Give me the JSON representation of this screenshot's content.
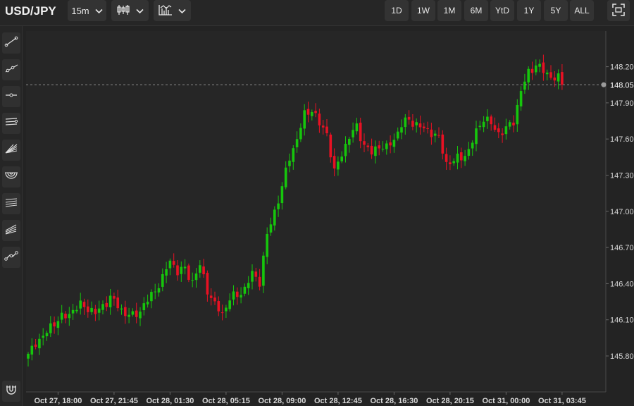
{
  "header": {
    "symbol": "USD/JPY",
    "interval": "15m",
    "chart_type_icon": "candlestick-icon",
    "indicators_icon": "indicators-icon",
    "ranges": [
      "1D",
      "1W",
      "1M",
      "6M",
      "YtD",
      "1Y",
      "5Y",
      "ALL"
    ],
    "fullscreen_icon": "fullscreen-icon"
  },
  "sidebar": {
    "tools": [
      "trend-line-icon",
      "ray-icon",
      "horizontal-line-icon",
      "parallel-channel-icon",
      "fib-fan-icon",
      "fib-arcs-icon",
      "fib-retracement-icon",
      "pitchfork-icon",
      "polyline-icon"
    ],
    "bottom_tool": "magnet-icon"
  },
  "chart_data": {
    "type": "candlestick",
    "y_ticks": [
      145.8,
      146.1,
      146.4,
      146.7,
      147.0,
      147.3,
      147.6,
      147.9,
      148.2
    ],
    "y_tick_labels": [
      "145.80",
      "146.10",
      "146.40",
      "146.70",
      "147.00",
      "147.30",
      "147.60",
      "147.90",
      "148.20"
    ],
    "ylim": [
      145.53,
      148.5
    ],
    "x_tick_labels": [
      "Oct 27, 18:00",
      "Oct 27, 21:45",
      "Oct 28, 01:30",
      "Oct 28, 05:15",
      "Oct 28, 09:00",
      "Oct 28, 12:45",
      "Oct 28, 16:30",
      "Oct 28, 20:15",
      "Oct 31, 00:00",
      "Oct 31, 03:45"
    ],
    "x_tick_index": [
      8,
      23,
      38,
      53,
      68,
      83,
      98,
      113,
      128,
      143
    ],
    "n_bars": 144,
    "last_price": 148.05,
    "last_price_label": "148.05",
    "grid": false,
    "colors": {
      "up": "#16c60c",
      "down": "#e81123",
      "background": "#262626",
      "axis_text": "#d8d8d8",
      "price_line": "#8a8a8a"
    },
    "anchors": [
      [
        0,
        145.8
      ],
      [
        2,
        145.92
      ],
      [
        4,
        145.95
      ],
      [
        6,
        146.05
      ],
      [
        8,
        146.1
      ],
      [
        10,
        146.13
      ],
      [
        12,
        146.18
      ],
      [
        14,
        146.22
      ],
      [
        16,
        146.2
      ],
      [
        18,
        146.15
      ],
      [
        20,
        146.22
      ],
      [
        22,
        146.28
      ],
      [
        24,
        146.22
      ],
      [
        26,
        146.15
      ],
      [
        28,
        146.13
      ],
      [
        30,
        146.18
      ],
      [
        32,
        146.26
      ],
      [
        34,
        146.35
      ],
      [
        36,
        146.44
      ],
      [
        38,
        146.6
      ],
      [
        40,
        146.5
      ],
      [
        42,
        146.52
      ],
      [
        44,
        146.42
      ],
      [
        46,
        146.55
      ],
      [
        48,
        146.35
      ],
      [
        50,
        146.22
      ],
      [
        52,
        146.15
      ],
      [
        54,
        146.28
      ],
      [
        56,
        146.3
      ],
      [
        58,
        146.36
      ],
      [
        60,
        146.48
      ],
      [
        62,
        146.42
      ],
      [
        64,
        146.8
      ],
      [
        66,
        147.0
      ],
      [
        68,
        147.2
      ],
      [
        70,
        147.45
      ],
      [
        72,
        147.6
      ],
      [
        74,
        147.8
      ],
      [
        76,
        147.85
      ],
      [
        78,
        147.72
      ],
      [
        80,
        147.65
      ],
      [
        82,
        147.32
      ],
      [
        84,
        147.48
      ],
      [
        86,
        147.62
      ],
      [
        88,
        147.7
      ],
      [
        90,
        147.55
      ],
      [
        92,
        147.48
      ],
      [
        94,
        147.55
      ],
      [
        96,
        147.52
      ],
      [
        98,
        147.6
      ],
      [
        100,
        147.72
      ],
      [
        102,
        147.76
      ],
      [
        104,
        147.72
      ],
      [
        106,
        147.68
      ],
      [
        108,
        147.66
      ],
      [
        110,
        147.6
      ],
      [
        112,
        147.4
      ],
      [
        114,
        147.42
      ],
      [
        116,
        147.45
      ],
      [
        118,
        147.5
      ],
      [
        120,
        147.66
      ],
      [
        122,
        147.78
      ],
      [
        124,
        147.72
      ],
      [
        126,
        147.65
      ],
      [
        128,
        147.68
      ],
      [
        130,
        147.75
      ],
      [
        132,
        148.0
      ],
      [
        134,
        148.15
      ],
      [
        136,
        148.22
      ],
      [
        138,
        148.16
      ],
      [
        140,
        148.12
      ],
      [
        142,
        148.1
      ],
      [
        143,
        148.05
      ]
    ]
  }
}
